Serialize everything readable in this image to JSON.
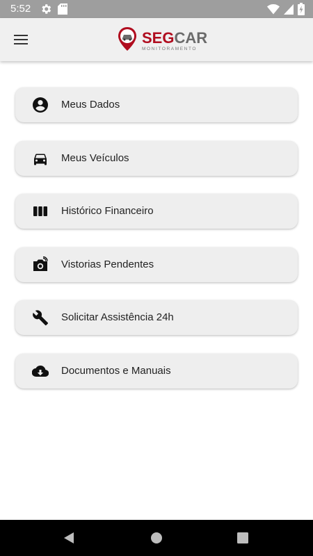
{
  "status_bar": {
    "time": "5:52"
  },
  "app_bar": {
    "logo": {
      "brand_seg": "SEG",
      "brand_car": "CAR",
      "tagline": "MONITORAMENTO"
    }
  },
  "menu": {
    "items": [
      {
        "label": "Meus Dados",
        "icon": "account-circle-icon"
      },
      {
        "label": "Meus Veículos",
        "icon": "car-icon"
      },
      {
        "label": "Histórico Financeiro",
        "icon": "columns-icon"
      },
      {
        "label": "Vistorias Pendentes",
        "icon": "camera-icon"
      },
      {
        "label": "Solicitar Assistência 24h",
        "icon": "wrench-icon"
      },
      {
        "label": "Documentos e Manuais",
        "icon": "cloud-download-icon"
      }
    ]
  },
  "colors": {
    "brand_red": "#b00d1f",
    "brand_gray": "#6b6b6b",
    "card_bg": "#eeeeee",
    "status_bar": "#9e9e9e"
  }
}
